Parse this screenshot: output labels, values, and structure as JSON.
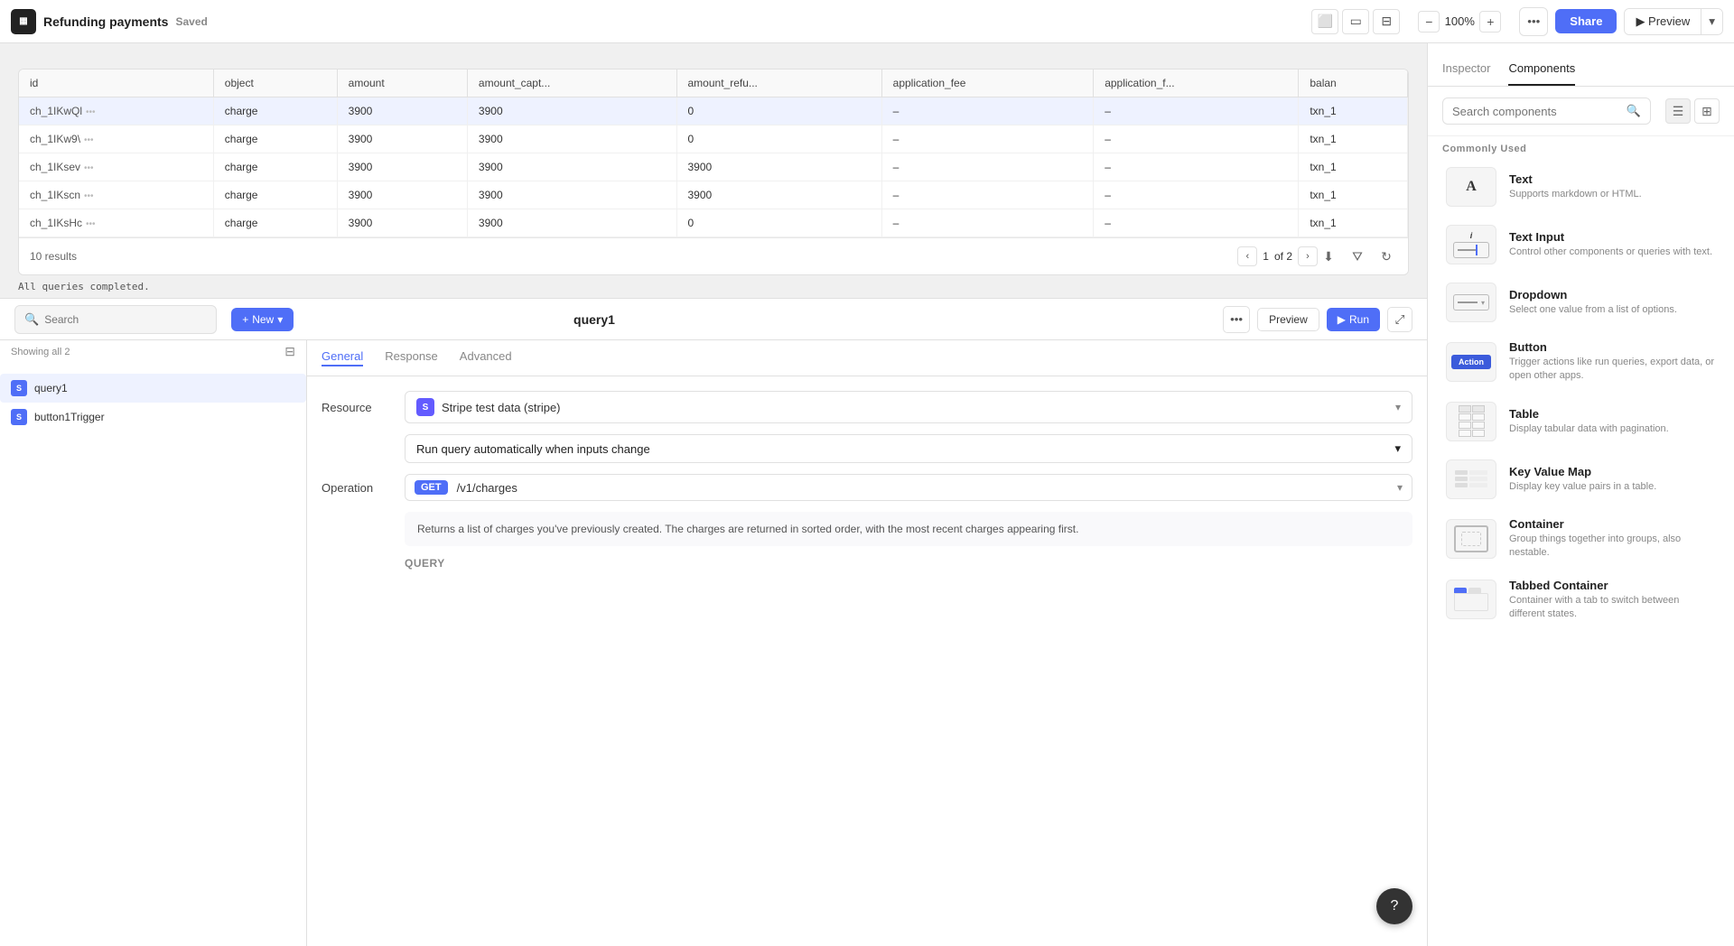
{
  "topbar": {
    "logo_icon": "▦",
    "title": "Refunding payments",
    "saved_label": "Saved",
    "zoom_minus": "−",
    "zoom_level": "100%",
    "zoom_plus": "+",
    "more_label": "•••",
    "share_label": "Share",
    "preview_label": "▶ Preview"
  },
  "table": {
    "columns": [
      "id",
      "object",
      "amount",
      "amount_capt...",
      "amount_refu...",
      "application_fee",
      "application_f...",
      "balan"
    ],
    "rows": [
      {
        "id": "ch_1IKwQl",
        "object": "charge",
        "amount": "3900",
        "amount_capt": "3900",
        "amount_refu": "0",
        "app_fee": "–",
        "app_f": "–",
        "balan": "txn_1",
        "selected": true
      },
      {
        "id": "ch_1IKw9\\",
        "object": "charge",
        "amount": "3900",
        "amount_capt": "3900",
        "amount_refu": "0",
        "app_fee": "–",
        "app_f": "–",
        "balan": "txn_1",
        "selected": false
      },
      {
        "id": "ch_1IKsev",
        "object": "charge",
        "amount": "3900",
        "amount_capt": "3900",
        "amount_refu": "3900",
        "app_fee": "–",
        "app_f": "–",
        "balan": "txn_1",
        "selected": false
      },
      {
        "id": "ch_1IKscn",
        "object": "charge",
        "amount": "3900",
        "amount_capt": "3900",
        "amount_refu": "3900",
        "app_fee": "–",
        "app_f": "–",
        "balan": "txn_1",
        "selected": false
      },
      {
        "id": "ch_1IKsHc",
        "object": "charge",
        "amount": "3900",
        "amount_capt": "3900",
        "amount_refu": "0",
        "app_fee": "–",
        "app_f": "–",
        "balan": "txn_1",
        "selected": false
      }
    ],
    "results_count": "10 results",
    "page_current": "1",
    "page_of": "of 2"
  },
  "status_bar": {
    "message": "All queries completed."
  },
  "query_panel": {
    "search_placeholder": "Search",
    "new_label": "+ New",
    "query_name": "query1",
    "showing_label": "Showing all 2",
    "queries": [
      {
        "name": "query1",
        "active": true
      },
      {
        "name": "button1Trigger",
        "active": false
      }
    ]
  },
  "query_editor": {
    "tabs": [
      "General",
      "Response",
      "Advanced"
    ],
    "active_tab": "General",
    "resource_label": "Resource",
    "resource_icon": "S",
    "resource_name": "Stripe test data (stripe)",
    "auto_run_label": "Run query automatically when inputs change",
    "operation_label": "Operation",
    "get_badge": "GET",
    "operation_path": "/v1/charges",
    "operation_desc": "Returns a list of charges you've previously created. The charges are returned in sorted order, with the most recent charges appearing first.",
    "query_label": "QUERY"
  },
  "right_panel": {
    "tabs": [
      "Inspector",
      "Components"
    ],
    "active_tab": "Components",
    "search_placeholder": "Search components",
    "commonly_used_label": "Commonly Used",
    "components": [
      {
        "name": "Text",
        "desc": "Supports markdown or HTML.",
        "icon_type": "text"
      },
      {
        "name": "Text Input",
        "desc": "Control other components or queries with text.",
        "icon_type": "text-input"
      },
      {
        "name": "Dropdown",
        "desc": "Select one value from a list of options.",
        "icon_type": "dropdown"
      },
      {
        "name": "Button",
        "desc": "Trigger actions like run queries, export data, or open other apps.",
        "icon_type": "button"
      },
      {
        "name": "Table",
        "desc": "Display tabular data with pagination.",
        "icon_type": "table"
      },
      {
        "name": "Key Value Map",
        "desc": "Display key value pairs in a table.",
        "icon_type": "key-value"
      },
      {
        "name": "Container",
        "desc": "Group things together into groups, also nestable.",
        "icon_type": "container"
      },
      {
        "name": "Tabbed Container",
        "desc": "Container with a tab to switch between different states.",
        "icon_type": "tabbed-container"
      }
    ]
  }
}
